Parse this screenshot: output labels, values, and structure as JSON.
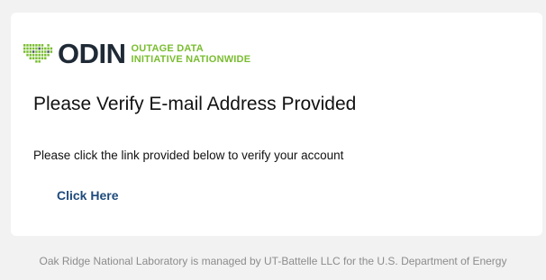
{
  "logo": {
    "word": "ODIN",
    "tagline_line1": "OUTAGE DATA",
    "tagline_line2": "INITIATIVE NATIONWIDE",
    "icon": "us-map-dots-icon",
    "colors": {
      "word": "#1f2a36",
      "tagline": "#79bd2f",
      "dots_green": "#79bd2f",
      "dots_dark": "#4a5568"
    }
  },
  "email": {
    "heading": "Please Verify E-mail Address Provided",
    "body": "Please click the link provided below to verify your account",
    "link_label": "Click Here",
    "link_color": "#1d4a7c"
  },
  "footer": {
    "text": "Oak Ridge National Laboratory is managed by UT-Battelle LLC for the U.S. Department of Energy"
  }
}
